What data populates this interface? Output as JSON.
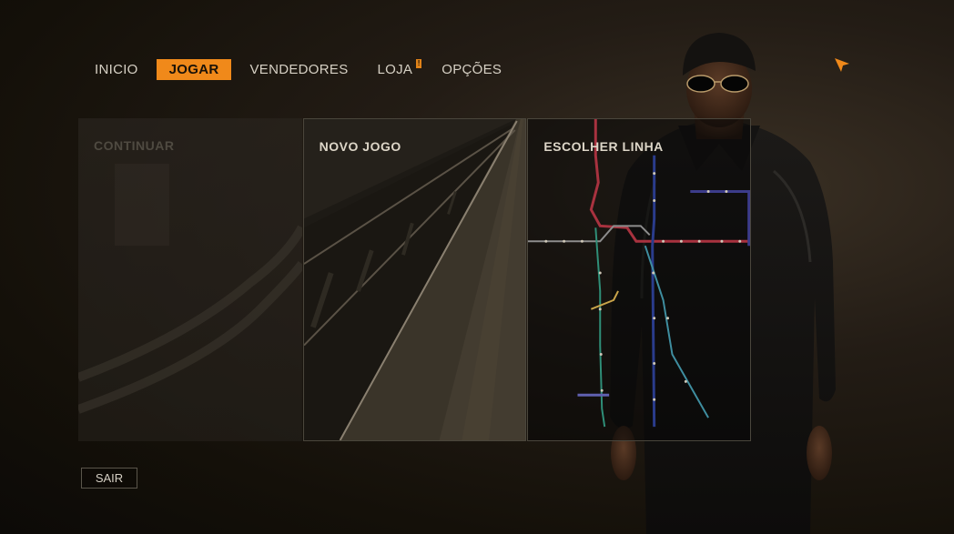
{
  "nav": {
    "items": [
      {
        "label": "INICIO",
        "active": false
      },
      {
        "label": "JOGAR",
        "active": true
      },
      {
        "label": "VENDEDORES",
        "active": false
      },
      {
        "label": "LOJA",
        "active": false,
        "badge": "!"
      },
      {
        "label": "OPÇÕES",
        "active": false
      }
    ]
  },
  "cards": [
    {
      "title": "CONTINUAR",
      "enabled": false
    },
    {
      "title": "NOVO JOGO",
      "enabled": true
    },
    {
      "title": "ESCOLHER LINHA",
      "enabled": true
    }
  ],
  "exit_label": "SAIR",
  "colors": {
    "accent": "#f0891a",
    "background": "#1a1510",
    "card_border": "#4a463c"
  },
  "icons": {
    "cursor": "navigation-arrow-icon"
  }
}
